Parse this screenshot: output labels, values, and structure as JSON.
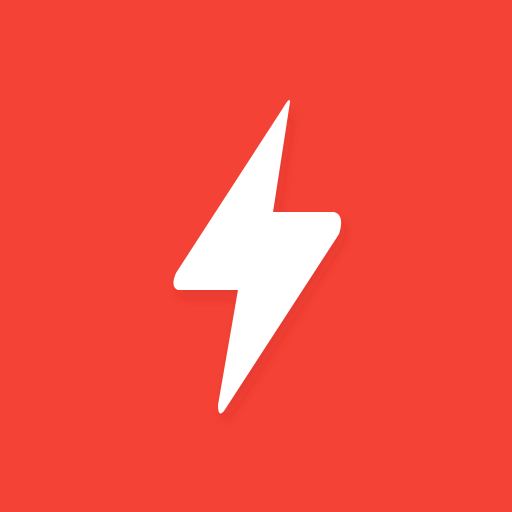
{
  "icon": {
    "name": "lightning-bolt-icon",
    "background_color": "#F44336",
    "glyph_color": "#FFFFFF",
    "shadow_color": "#C62828"
  }
}
